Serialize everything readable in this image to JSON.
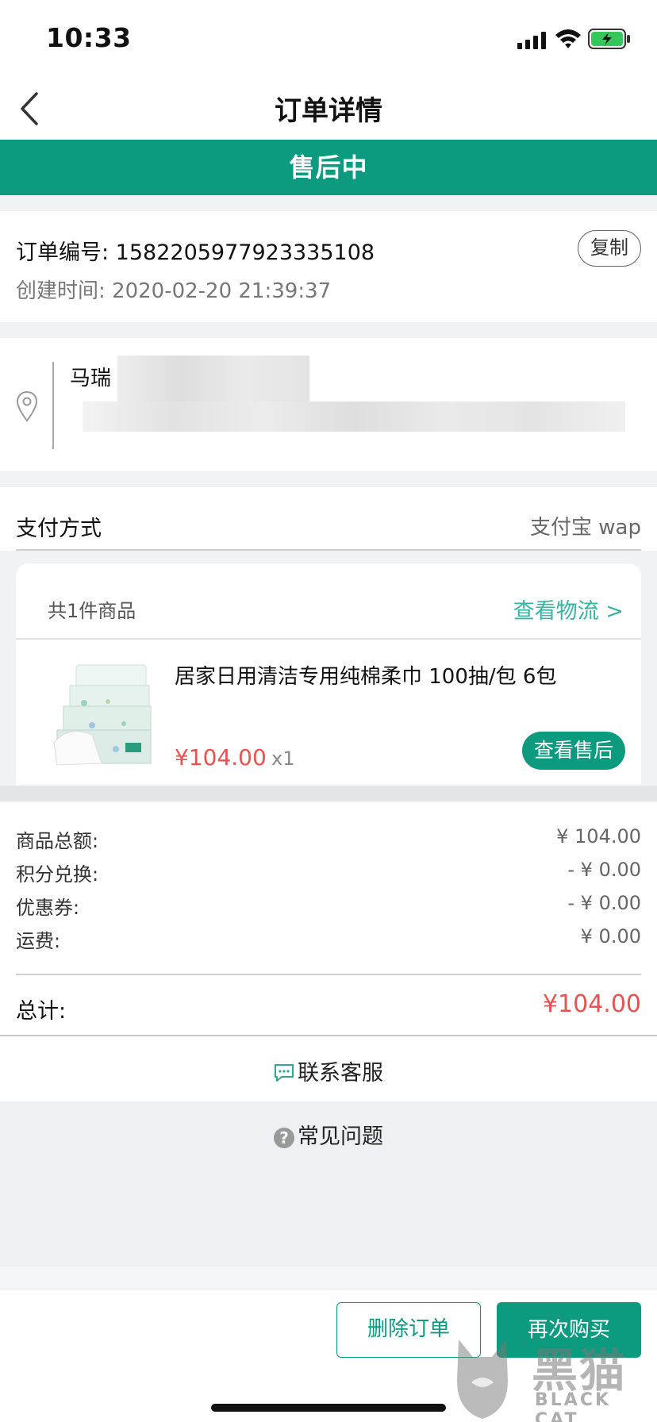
{
  "status_bar": {
    "time": "10:33"
  },
  "nav": {
    "title": "订单详情"
  },
  "banner": {
    "status": "售后中"
  },
  "order": {
    "number": "订单编号: 1582205977923335108",
    "created": "创建时间: 2020-02-20 21:39:37",
    "copy_label": "复制"
  },
  "address": {
    "name": "马瑞"
  },
  "payment": {
    "label": "支付方式",
    "value": "支付宝 wap"
  },
  "product_card": {
    "count_label": "共1件商品",
    "logistics_label": "查看物流 >",
    "product": {
      "name": "居家日用清洁专用纯棉柔巾 100抽/包 6包",
      "price": "¥104.00",
      "qty": "x1",
      "aftersale_label": "查看售后"
    }
  },
  "amounts": {
    "rows": [
      {
        "label": "商品总额:",
        "value": "¥ 104.00"
      },
      {
        "label": "积分兑换:",
        "value": "- ¥ 0.00"
      },
      {
        "label": "优惠券:",
        "value": "- ¥ 0.00"
      },
      {
        "label": "运费:",
        "value": "¥ 0.00"
      }
    ],
    "total_label": "总计:",
    "total_value": "¥104.00"
  },
  "contact": {
    "label": "联系客服"
  },
  "faq": {
    "label": "常见问题"
  },
  "actions": {
    "delete_label": "删除订单",
    "rebuy_label": "再次购买"
  },
  "watermark": {
    "cn": "黑猫",
    "en": "BLACK CAT"
  },
  "colors": {
    "brand": "#0d9b80",
    "price": "#e8534f",
    "link": "#34b6a2"
  },
  "icons": [
    "back-chevron-icon",
    "location-pin-icon",
    "chat-bubble-icon",
    "question-circle-icon",
    "signal-icon",
    "wifi-icon",
    "battery-icon"
  ]
}
